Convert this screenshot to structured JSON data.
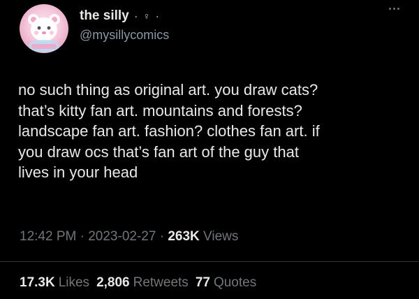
{
  "author": {
    "display_name": "the silly",
    "separator": "·",
    "emoji": "♀",
    "trailing_dot": "·",
    "handle": "@mysillycomics"
  },
  "tweet": {
    "lines": [
      "no such thing as original art. you draw cats?",
      "that’s kitty fan art. mountains and forests?",
      "landscape fan art. fashion? clothes fan art. if",
      "you draw ocs that’s fan art of the guy that",
      "lives in your head"
    ]
  },
  "meta": {
    "time": "12:42 PM",
    "sep1": " · ",
    "date": "2023-02-27",
    "sep2": " · ",
    "views_count": "263K",
    "views_label": " Views"
  },
  "stats": {
    "likes_count": "17.3K",
    "likes_label": "Likes",
    "retweets_count": "2,806",
    "retweets_label": "Retweets",
    "quotes_count": "77",
    "quotes_label": "Quotes"
  },
  "colors": {
    "background": "#000000",
    "primary_text": "#e7e9ea",
    "secondary_text": "#71767b",
    "avatar_pink": "#f5c9dc"
  }
}
